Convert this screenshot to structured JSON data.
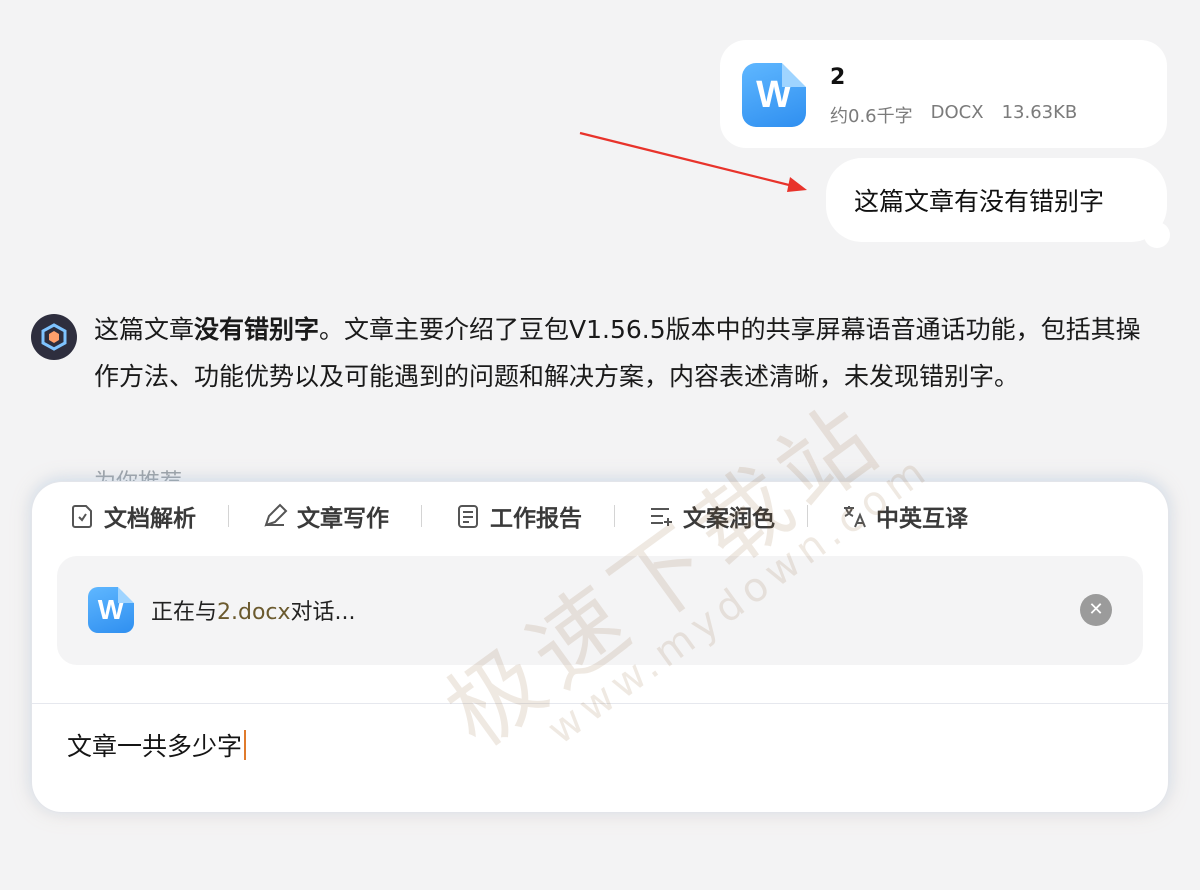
{
  "file_card": {
    "icon_letter": "W",
    "name": "2",
    "meta_words": "约0.6千字",
    "meta_type": "DOCX",
    "meta_size": "13.63KB"
  },
  "user_message": "这篇文章有没有错别字",
  "bot_reply": {
    "prefix": "这篇文章",
    "bold": "没有错别字",
    "suffix": "。文章主要介绍了豆包V1.56.5版本中的共享屏幕语音通话功能，包括其操作方法、功能优势以及可能遇到的问题和解决方案，内容表述清晰，未发现错别字。"
  },
  "recommend_label": "为你推荐",
  "skills": [
    {
      "label": "文档解析",
      "icon": "doc-parse-icon"
    },
    {
      "label": "文章写作",
      "icon": "pen-icon"
    },
    {
      "label": "工作报告",
      "icon": "report-icon"
    },
    {
      "label": "文案润色",
      "icon": "polish-icon"
    },
    {
      "label": "中英互译",
      "icon": "translate-icon"
    }
  ],
  "attachment": {
    "icon_letter": "W",
    "prefix": "正在与",
    "filename": "2.docx",
    "suffix": "对话..."
  },
  "input_value": "文章一共多少字",
  "watermark": {
    "cn": "极速下载站",
    "en": "www.mydown.com"
  },
  "colors": {
    "arrow": "#e8332b",
    "caret": "#e07b2c",
    "word_blue": "#2f8ff0"
  }
}
